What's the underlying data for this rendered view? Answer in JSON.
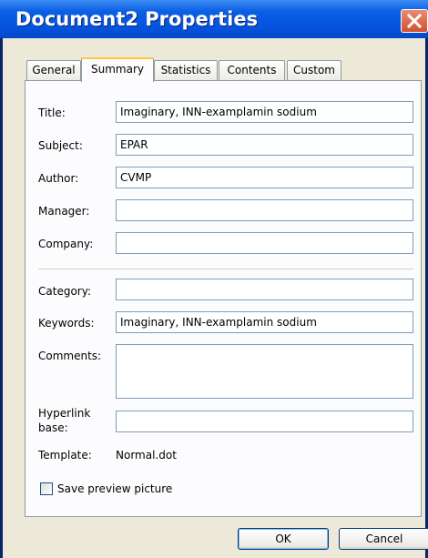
{
  "window": {
    "title": "Document2 Properties"
  },
  "tabs": [
    {
      "label": "General"
    },
    {
      "label": "Summary"
    },
    {
      "label": "Statistics"
    },
    {
      "label": "Contents"
    },
    {
      "label": "Custom"
    }
  ],
  "active_tab": "Summary",
  "fields": {
    "title": {
      "label": "Title:",
      "value": "Imaginary, INN-examplamin sodium"
    },
    "subject": {
      "label": "Subject:",
      "value": "EPAR"
    },
    "author": {
      "label": "Author:",
      "value": "CVMP"
    },
    "manager": {
      "label": "Manager:",
      "value": ""
    },
    "company": {
      "label": "Company:",
      "value": ""
    },
    "category": {
      "label": "Category:",
      "value": ""
    },
    "keywords": {
      "label": "Keywords:",
      "value": "Imaginary, INN-examplamin sodium"
    },
    "comments": {
      "label": "Comments:",
      "value": ""
    },
    "hyperlink_base": {
      "label_line1": "Hyperlink",
      "label_line2": "base:",
      "value": ""
    },
    "template": {
      "label": "Template:",
      "value": "Normal.dot"
    }
  },
  "save_preview": {
    "label": "Save preview picture",
    "checked": false
  },
  "buttons": {
    "ok": "OK",
    "cancel": "Cancel"
  },
  "colors": {
    "titlebar": "#0554E0",
    "dialog_bg": "#ECE9D8",
    "tab_highlight": "#FFC83C",
    "input_border": "#7F9DB9",
    "close_button": "#D34F2C"
  }
}
